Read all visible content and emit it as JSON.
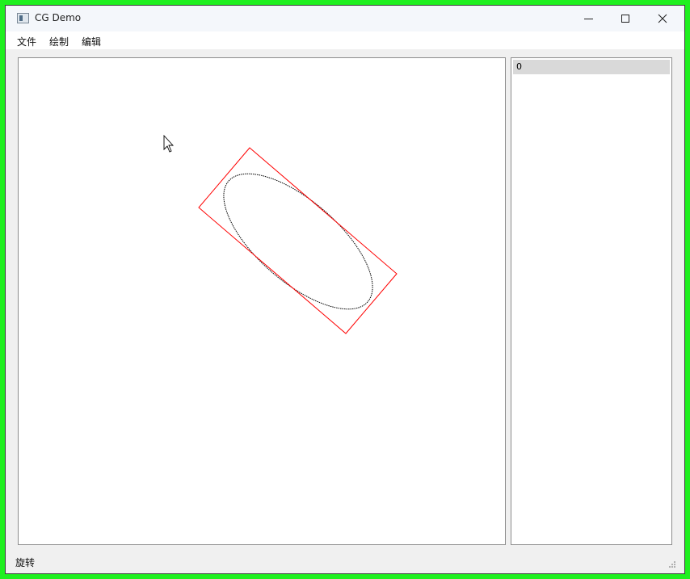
{
  "window": {
    "title": "CG Demo",
    "icon": "app-icon",
    "controls": [
      "minimize-icon",
      "maximize-icon",
      "close-icon"
    ]
  },
  "menubar": {
    "items": [
      {
        "label": "文件"
      },
      {
        "label": "绘制"
      },
      {
        "label": "编辑"
      }
    ]
  },
  "canvas": {
    "shapes": [
      {
        "type": "ellipse",
        "stroke": "#000000",
        "style": "dotted"
      },
      {
        "type": "bounding-rectangle",
        "stroke": "#ff0000"
      }
    ],
    "cursor": "arrow-cursor-icon"
  },
  "item_list": {
    "items": [
      {
        "label": "0",
        "selected": true
      }
    ]
  },
  "statusbar": {
    "text": "旋转"
  },
  "colors": {
    "frame_highlight": "#1ff01f",
    "selection_box": "#ff0000",
    "list_selected": "#d9d9d9"
  }
}
